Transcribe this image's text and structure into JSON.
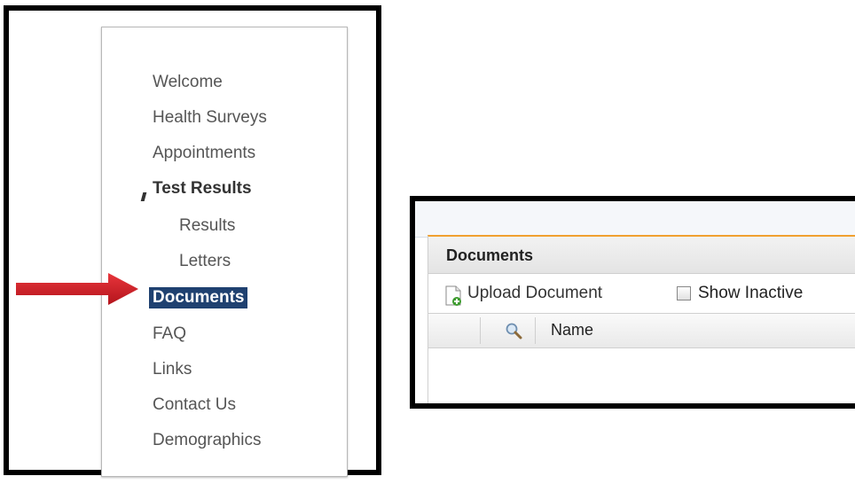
{
  "nav": {
    "items": [
      {
        "label": "Welcome"
      },
      {
        "label": "Health Surveys"
      },
      {
        "label": "Appointments"
      },
      {
        "label": "Test Results"
      },
      {
        "label": "Results"
      },
      {
        "label": "Letters"
      },
      {
        "label": "Documents"
      },
      {
        "label": "FAQ"
      },
      {
        "label": "Links"
      },
      {
        "label": "Contact Us"
      },
      {
        "label": "Demographics"
      }
    ],
    "active_color": "#1f4170"
  },
  "annotation": {
    "arrow_color": "#d22027",
    "icon": "arrow-right-icon"
  },
  "documents_panel": {
    "title": "Documents",
    "accent_color": "#f0a030",
    "toolbar": {
      "upload_label": "Upload Document",
      "upload_icon": "document-add-icon",
      "show_inactive_label": "Show Inactive",
      "show_inactive_checked": false
    },
    "grid": {
      "search_icon": "magnifier-icon",
      "columns": [
        "Name"
      ]
    }
  }
}
